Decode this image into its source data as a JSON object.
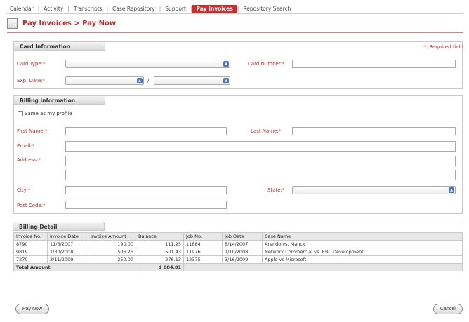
{
  "nav": {
    "items": [
      "Calendar",
      "Activity",
      "Transcripts",
      "Case Repository",
      "Support",
      "Pay Invoices",
      "Repository Search"
    ],
    "active_index": 5
  },
  "page": {
    "title": "Pay Invoices > Pay Now",
    "required_note": "*: Required field"
  },
  "card": {
    "tab": "Card Information",
    "card_type_label": "Card Type:*",
    "card_number_label": "Card Number:*",
    "exp_date_label": "Exp. Date:*",
    "exp_separator": "/"
  },
  "billing_info": {
    "tab": "Billing Information",
    "same_as_profile": "Same as my profile",
    "first_name_label": "First Name:*",
    "last_name_label": "Last Name:*",
    "email_label": "Email:*",
    "address_label": "Address:*",
    "city_label": "City:*",
    "state_label": "State:*",
    "postal_label": "Post Code:*"
  },
  "billing_detail": {
    "tab": "Billing Detail",
    "columns": [
      "Invoice No.",
      "Invoice Date",
      "Invoice Amount",
      "Balance",
      "Job No.",
      "Job Date",
      "Case Name"
    ],
    "rows": [
      [
        "8790",
        "11/5/2007",
        "190.00",
        "111.25",
        "11884",
        "8/14/2007",
        "Arendo vs. Manck"
      ],
      [
        "9819",
        "1/30/2008",
        "506.25",
        "501.43",
        "11976",
        "1/10/2008",
        "Network Commercial vs. RBC Development"
      ],
      [
        "7270",
        "3/11/2009",
        "250.00",
        "276.13",
        "12375",
        "3/16/2009",
        "Apple vs Microsoft"
      ]
    ],
    "total_label": "Total Amount",
    "total_value": "$ 884.81"
  },
  "buttons": {
    "pay_now": "Pay Now",
    "cancel": "Cancel"
  },
  "colors": {
    "accent": "#b92d2d",
    "select_arrow": "#4a73c9"
  }
}
